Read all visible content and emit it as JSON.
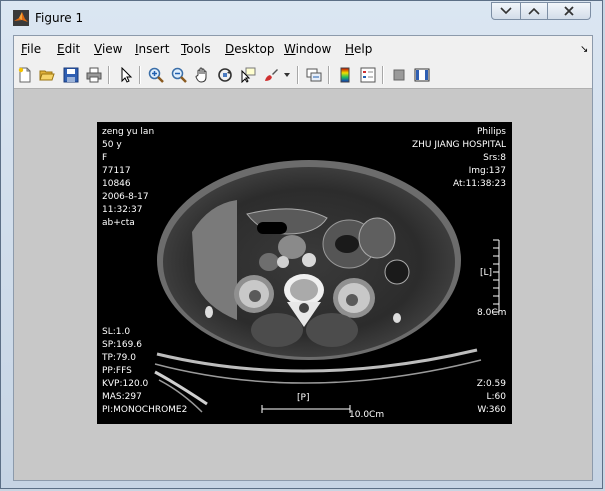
{
  "window": {
    "title": "Figure 1"
  },
  "menu": [
    {
      "label": "File",
      "ul": "F",
      "rest": "ile"
    },
    {
      "label": "Edit",
      "ul": "E",
      "rest": "dit"
    },
    {
      "label": "View",
      "ul": "V",
      "rest": "iew"
    },
    {
      "label": "Insert",
      "ul": "I",
      "rest": "nsert"
    },
    {
      "label": "Tools",
      "ul": "T",
      "rest": "ools"
    },
    {
      "label": "Desktop",
      "ul": "D",
      "rest": "esktop"
    },
    {
      "label": "Window",
      "ul": "W",
      "rest": "indow"
    },
    {
      "label": "Help",
      "ul": "H",
      "rest": "elp"
    }
  ],
  "toolbar": {
    "icons": [
      "new-figure-icon",
      "open-file-icon",
      "save-figure-icon",
      "print-figure-icon",
      "edit-plot-arrow-icon",
      "zoom-in-icon",
      "zoom-out-icon",
      "pan-hand-icon",
      "rotate-3d-icon",
      "data-cursor-icon",
      "brush-icon",
      "brush-dropdown-icon",
      "link-plot-icon",
      "insert-colorbar-icon",
      "insert-legend-icon",
      "hide-plot-tools-icon",
      "show-plot-tools-icon"
    ]
  },
  "image": {
    "top_left": [
      "zeng yu lan",
      "50 y",
      "F",
      "77117",
      "10846",
      "2006-8-17",
      "11:32:37",
      "ab+cta"
    ],
    "top_right": [
      "Philips",
      "ZHU JIANG HOSPITAL",
      "Srs:8",
      "Img:137",
      "At:11:38:23"
    ],
    "bottom_left": [
      "SL:1.0",
      "SP:169.6",
      "TP:79.0",
      "PP:FFS",
      "KVP:120.0",
      "MAS:297",
      "PI:MONOCHROME2"
    ],
    "bottom_right": [
      "Z:0.59",
      "L:60",
      "W:360"
    ],
    "side_marker": "[L]",
    "bottom_marker": "[P]",
    "vscale_label": "8.0Cm",
    "hscale_label": "10.0Cm"
  }
}
